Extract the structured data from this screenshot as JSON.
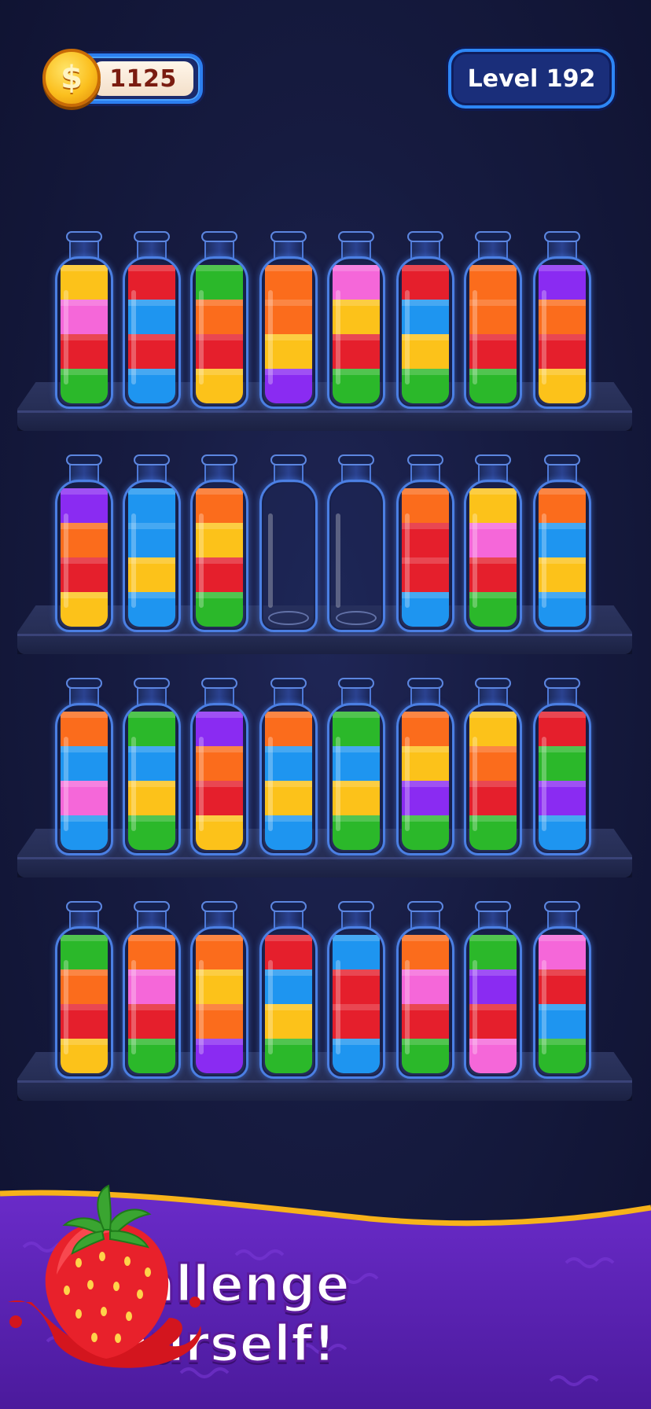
{
  "hud": {
    "coins": "1125",
    "coin_icon": "dollar-coin-icon",
    "level_label": "Level 192"
  },
  "palette": {
    "yellow": "#fcc21a",
    "pink": "#f567d9",
    "red": "#e51f2c",
    "green": "#2bb82a",
    "blue": "#1e95f0",
    "orange": "#fb6c1c",
    "purple": "#8a2bf2"
  },
  "shelves": [
    {
      "bottles": [
        [
          "green",
          "red",
          "pink",
          "yellow"
        ],
        [
          "blue",
          "red",
          "blue",
          "red"
        ],
        [
          "yellow",
          "red",
          "orange",
          "green"
        ],
        [
          "purple",
          "yellow",
          "orange",
          "orange"
        ],
        [
          "green",
          "red",
          "yellow",
          "pink"
        ],
        [
          "green",
          "yellow",
          "blue",
          "red"
        ],
        [
          "green",
          "red",
          "orange",
          "orange"
        ],
        [
          "yellow",
          "red",
          "orange",
          "purple"
        ]
      ]
    },
    {
      "bottles": [
        [
          "yellow",
          "red",
          "orange",
          "purple"
        ],
        [
          "blue",
          "yellow",
          "blue",
          "blue"
        ],
        [
          "green",
          "red",
          "yellow",
          "orange"
        ],
        [],
        [],
        [
          "blue",
          "red",
          "red",
          "orange"
        ],
        [
          "green",
          "red",
          "pink",
          "yellow"
        ],
        [
          "blue",
          "yellow",
          "blue",
          "orange"
        ]
      ]
    },
    {
      "bottles": [
        [
          "blue",
          "pink",
          "blue",
          "orange"
        ],
        [
          "green",
          "yellow",
          "blue",
          "green"
        ],
        [
          "yellow",
          "red",
          "orange",
          "purple"
        ],
        [
          "blue",
          "yellow",
          "blue",
          "orange"
        ],
        [
          "green",
          "yellow",
          "blue",
          "green"
        ],
        [
          "green",
          "purple",
          "yellow",
          "orange"
        ],
        [
          "green",
          "red",
          "orange",
          "yellow"
        ],
        [
          "blue",
          "purple",
          "green",
          "red"
        ]
      ]
    },
    {
      "bottles": [
        [
          "yellow",
          "red",
          "orange",
          "green"
        ],
        [
          "green",
          "red",
          "pink",
          "orange"
        ],
        [
          "purple",
          "orange",
          "yellow",
          "orange"
        ],
        [
          "green",
          "yellow",
          "blue",
          "red"
        ],
        [
          "blue",
          "red",
          "red",
          "blue"
        ],
        [
          "green",
          "red",
          "pink",
          "orange"
        ],
        [
          "pink",
          "red",
          "purple",
          "green"
        ],
        [
          "green",
          "blue",
          "red",
          "pink"
        ]
      ]
    }
  ],
  "banner": {
    "line1": "Challenge",
    "line2": "Yourself!",
    "art": "strawberry-icon",
    "background": "#5a21b5",
    "border": "#f7b21a"
  }
}
